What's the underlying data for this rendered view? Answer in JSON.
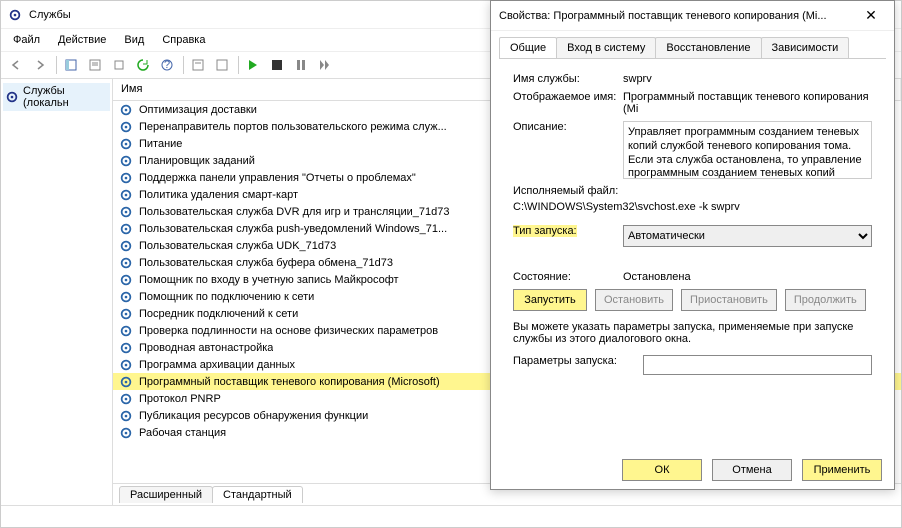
{
  "window": {
    "title": "Службы"
  },
  "menu": {
    "file": "Файл",
    "action": "Действие",
    "view": "Вид",
    "help": "Справка"
  },
  "left": {
    "node": "Службы (локальн"
  },
  "list": {
    "header": "Имя",
    "items": [
      "Оптимизация доставки",
      "Перенаправитель портов пользовательского режима служ...",
      "Питание",
      "Планировщик заданий",
      "Поддержка панели управления \"Отчеты о проблемах\"",
      "Политика удаления смарт-карт",
      "Пользовательская служба DVR для игр и трансляции_71d73",
      "Пользовательская служба push-уведомлений Windows_71...",
      "Пользовательская служба UDK_71d73",
      "Пользовательская служба буфера обмена_71d73",
      "Помощник по входу в учетную запись Майкрософт",
      "Помощник по подключению к сети",
      "Посредник подключений к сети",
      "Проверка подлинности на основе физических параметров",
      "Проводная автонастройка",
      "Программа архивации данных",
      "Программный поставщик теневого копирования (Microsoft)",
      "Протокол PNRP",
      "Публикация ресурсов обнаружения функции",
      "Рабочая станция"
    ],
    "selected_index": 16
  },
  "tabs": {
    "ext": "Расширенный",
    "std": "Стандартный"
  },
  "dialog": {
    "title": "Свойства: Программный поставщик теневого копирования (Mi...",
    "tabs": {
      "general": "Общие",
      "logon": "Вход в систему",
      "recovery": "Восстановление",
      "deps": "Зависимости"
    },
    "labels": {
      "svc_name": "Имя службы:",
      "disp_name": "Отображаемое имя:",
      "desc": "Описание:",
      "exe": "Исполняемый файл:",
      "startup": "Тип запуска:",
      "state": "Состояние:",
      "hint": "Вы можете указать параметры запуска, применяемые при запуске службы из этого диалогового окна.",
      "params": "Параметры запуска:"
    },
    "values": {
      "svc_name": "swprv",
      "disp_name": "Программный поставщик теневого копирования (Mi",
      "desc": "Управляет программным созданием теневых копий службой теневого копирования тома. Если эта служба остановлена, то управление программным созданием теневых копий",
      "exe": "C:\\WINDOWS\\System32\\svchost.exe -k swprv",
      "startup": "Автоматически",
      "state": "Остановлена",
      "params": ""
    },
    "buttons": {
      "start": "Запустить",
      "stop": "Остановить",
      "pause": "Приостановить",
      "resume": "Продолжить",
      "ok": "ОК",
      "cancel": "Отмена",
      "apply": "Применить"
    }
  }
}
